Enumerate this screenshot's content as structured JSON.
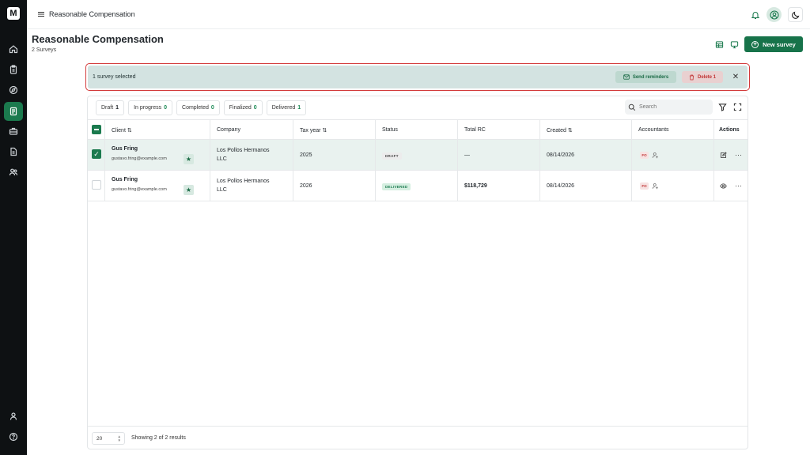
{
  "app": {
    "title": "Reasonable Compensation",
    "logo_letter": "M"
  },
  "sidebar": {
    "items": [
      {
        "name": "home-icon"
      },
      {
        "name": "clipboard-icon"
      },
      {
        "name": "compass-icon"
      },
      {
        "name": "survey-icon",
        "active": true
      },
      {
        "name": "briefcase-icon"
      },
      {
        "name": "document-icon"
      },
      {
        "name": "users-icon"
      }
    ],
    "bottom": [
      {
        "name": "user-icon"
      },
      {
        "name": "help-icon"
      }
    ]
  },
  "page": {
    "title": "Reasonable Compensation",
    "subtitle": "2 Surveys",
    "new_button": "New survey"
  },
  "selection": {
    "text": "1 survey selected",
    "send_label": "Send reminders",
    "delete_label": "Delete 1"
  },
  "filters": [
    {
      "label": "Draft",
      "count": "1"
    },
    {
      "label": "In progress",
      "count": "0"
    },
    {
      "label": "Completed",
      "count": "0"
    },
    {
      "label": "Finalized",
      "count": "0"
    },
    {
      "label": "Delivered",
      "count": "1"
    }
  ],
  "search": {
    "placeholder": "Search"
  },
  "columns": [
    "Client",
    "Company",
    "Tax year",
    "Status",
    "Total RC",
    "Created",
    "Accountants",
    "Actions"
  ],
  "rows": [
    {
      "selected": true,
      "client": "Gus Fring",
      "email": "gustavo.fring@example.com",
      "company_l1": "Los Pollos Hermanos",
      "company_l2": "LLC",
      "tax_year": "2025",
      "status": "DRAFT",
      "total_rc": "—",
      "created": "08/14/2026",
      "accountant": "FO"
    },
    {
      "selected": false,
      "client": "Gus Fring",
      "email": "gustavo.fring@example.com",
      "company_l1": "Los Pollos Hermanos",
      "company_l2": "LLC",
      "tax_year": "2026",
      "status": "DELIVERED",
      "total_rc": "$118,729",
      "created": "08/14/2026",
      "accountant": "FO"
    }
  ],
  "footer": {
    "page_size": "20",
    "results": "Showing 2 of 2 results"
  },
  "colors": {
    "brand": "#1b7a4e",
    "sidebar_bg": "#0e1113",
    "danger": "#d33a3a"
  }
}
